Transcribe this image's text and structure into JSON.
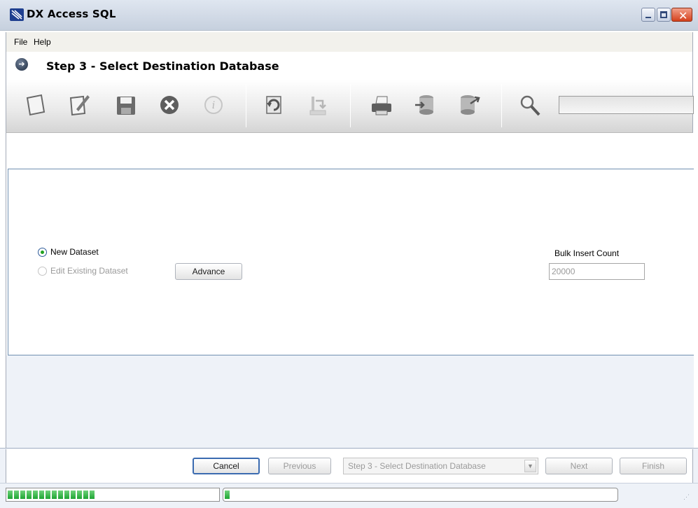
{
  "window": {
    "title": "DX Access SQL",
    "minimize_icon": "minimize-icon",
    "maximize_icon": "maximize-icon",
    "close_icon": "close-icon"
  },
  "menu": {
    "items": [
      {
        "label": "File"
      },
      {
        "label": "Help"
      }
    ]
  },
  "step": {
    "title": "Step 3 - Select Destination Database",
    "icon": "arrow-circle-icon"
  },
  "toolbar": {
    "buttons": [
      {
        "name": "new",
        "icon": "new-document-icon",
        "enabled": true
      },
      {
        "name": "edit",
        "icon": "edit-pencil-icon",
        "enabled": true
      },
      {
        "name": "save",
        "icon": "save-disk-icon",
        "enabled": true
      },
      {
        "name": "delete",
        "icon": "delete-circle-icon",
        "enabled": true
      },
      {
        "name": "info",
        "icon": "info-icon",
        "enabled": false
      },
      {
        "name": "refresh",
        "icon": "refresh-icon",
        "enabled": true
      },
      {
        "name": "import",
        "icon": "import-icon",
        "enabled": false
      },
      {
        "name": "print",
        "icon": "printer-icon",
        "enabled": true
      },
      {
        "name": "database-import",
        "icon": "database-import-icon",
        "enabled": true
      },
      {
        "name": "database-export",
        "icon": "database-export-icon",
        "enabled": true
      },
      {
        "name": "search",
        "icon": "search-magnifier-icon",
        "enabled": true
      }
    ],
    "search_value": ""
  },
  "options": {
    "new_dataset_label": "New Dataset",
    "new_dataset_checked": true,
    "edit_dataset_label": "Edit Existing Dataset",
    "edit_dataset_checked": false,
    "edit_dataset_enabled": false,
    "advance_label": "Advance",
    "bulk_insert_label": "Bulk Insert Count",
    "bulk_insert_value": "20000"
  },
  "nav": {
    "cancel_label": "Cancel",
    "previous_label": "Previous",
    "step_select_value": "Step 3 - Select Destination Database",
    "next_label": "Next",
    "finish_label": "Finish"
  },
  "status": {
    "left_progress_segments": 14,
    "right_progress_segments": 1
  },
  "colors": {
    "accent": "#3b6bb0",
    "progress": "#1ea533",
    "panel": "#eef2f8"
  }
}
